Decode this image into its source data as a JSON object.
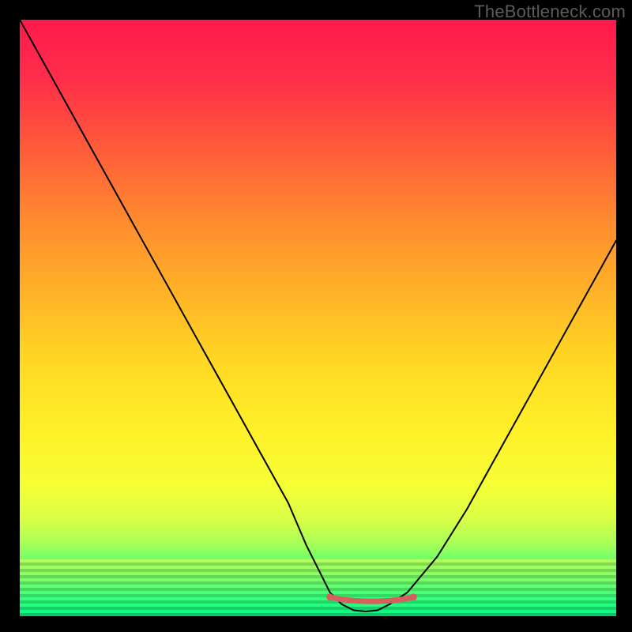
{
  "watermark": "TheBottleneck.com",
  "chart_data": {
    "type": "line",
    "title": "",
    "xlabel": "",
    "ylabel": "",
    "xlim": [
      0,
      100
    ],
    "ylim": [
      0,
      100
    ],
    "series": [
      {
        "name": "bottleneck-curve",
        "x": [
          0,
          5,
          10,
          15,
          20,
          25,
          30,
          35,
          40,
          45,
          48,
          50,
          52,
          54,
          56,
          58,
          60,
          62,
          65,
          70,
          75,
          80,
          85,
          90,
          95,
          100
        ],
        "y": [
          100,
          91,
          82,
          73,
          64,
          55,
          46,
          37,
          28,
          19,
          12,
          8,
          4,
          2,
          1,
          0.8,
          1,
          2,
          4,
          10,
          18,
          27,
          36,
          45,
          54,
          63
        ]
      },
      {
        "name": "flat-segment",
        "x": [
          52,
          54,
          56,
          58,
          60,
          62,
          64,
          66
        ],
        "y": [
          3.2,
          2.8,
          2.6,
          2.5,
          2.5,
          2.6,
          2.8,
          3.2
        ]
      }
    ],
    "gradient_stops": [
      {
        "pos": 0.0,
        "color": "#ff1a4d"
      },
      {
        "pos": 0.1,
        "color": "#ff2d4a"
      },
      {
        "pos": 0.22,
        "color": "#ff5a3a"
      },
      {
        "pos": 0.35,
        "color": "#ff8a2e"
      },
      {
        "pos": 0.48,
        "color": "#ffb327"
      },
      {
        "pos": 0.6,
        "color": "#ffd823"
      },
      {
        "pos": 0.72,
        "color": "#fff028"
      },
      {
        "pos": 0.82,
        "color": "#f5ff35"
      },
      {
        "pos": 0.88,
        "color": "#d6ff47"
      },
      {
        "pos": 0.92,
        "color": "#a8ff58"
      },
      {
        "pos": 0.95,
        "color": "#6cff68"
      },
      {
        "pos": 0.975,
        "color": "#2fff7a"
      },
      {
        "pos": 1.0,
        "color": "#00e57a"
      }
    ],
    "green_band_rows": 18,
    "flat_segment_color": "#d95f5f"
  }
}
